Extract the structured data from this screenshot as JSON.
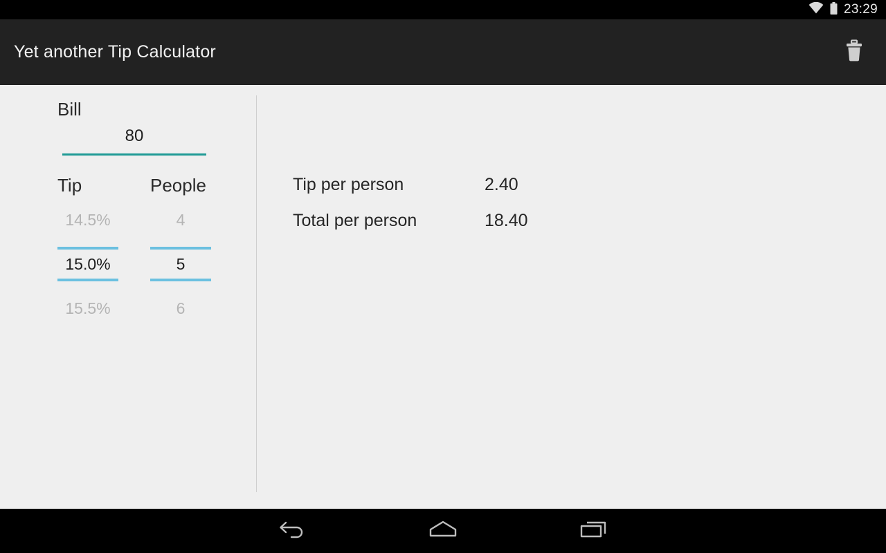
{
  "statusbar": {
    "clock": "23:29",
    "icons": [
      "wifi-icon",
      "battery-icon"
    ]
  },
  "actionbar": {
    "title": "Yet another Tip Calculator",
    "delete_icon": "trash-icon",
    "background": "#222222"
  },
  "bill": {
    "label": "Bill",
    "value": "80",
    "underline_color": "#1f9a95"
  },
  "pickers": {
    "divider_color": "#6bc0e0",
    "tip": {
      "header": "Tip",
      "previous": "14.5%",
      "selected": "15.0%",
      "next": "15.5%"
    },
    "people": {
      "header": "People",
      "previous": "4",
      "selected": "5",
      "next": "6"
    }
  },
  "results": [
    {
      "label": "Tip per person",
      "value": "2.40"
    },
    {
      "label": "Total per person",
      "value": "18.40"
    }
  ],
  "navbar": {
    "back": "back-icon",
    "home": "home-icon",
    "recents": "recents-icon"
  },
  "colors": {
    "background": "#efefef",
    "accent_teal": "#1f9a95",
    "accent_blue": "#6bc0e0"
  }
}
